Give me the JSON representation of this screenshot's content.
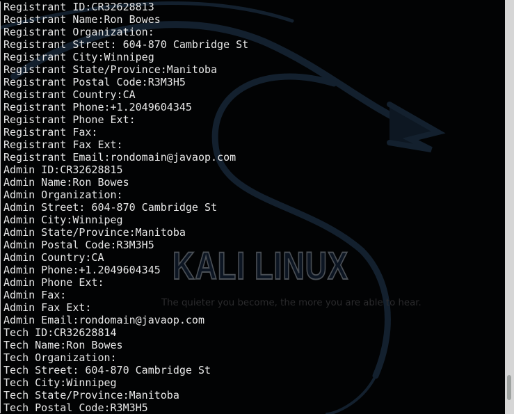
{
  "terminal": {
    "lines": [
      "Registrant ID:CR32628813",
      "Registrant Name:Ron Bowes",
      "Registrant Organization:",
      "Registrant Street: 604-870 Cambridge St",
      "Registrant City:Winnipeg",
      "Registrant State/Province:Manitoba",
      "Registrant Postal Code:R3M3H5",
      "Registrant Country:CA",
      "Registrant Phone:+1.2049604345",
      "Registrant Phone Ext:",
      "Registrant Fax:",
      "Registrant Fax Ext:",
      "Registrant Email:rondomain@javaop.com",
      "Admin ID:CR32628815",
      "Admin Name:Ron Bowes",
      "Admin Organization:",
      "Admin Street: 604-870 Cambridge St",
      "Admin City:Winnipeg",
      "Admin State/Province:Manitoba",
      "Admin Postal Code:R3M3H5",
      "Admin Country:CA",
      "Admin Phone:+1.2049604345",
      "Admin Phone Ext:",
      "Admin Fax:",
      "Admin Fax Ext:",
      "Admin Email:rondomain@javaop.com",
      "Tech ID:CR32628814",
      "Tech Name:Ron Bowes",
      "Tech Organization:",
      "Tech Street: 604-870 Cambridge St",
      "Tech City:Winnipeg",
      "Tech State/Province:Manitoba",
      "Tech Postal Code:R3M3H5"
    ]
  },
  "wallpaper": {
    "logo_text": "KALI LINUX",
    "tagline": "The quieter you become, the more you are able to hear."
  },
  "colors": {
    "background": "#020304",
    "text": "#e8e8e8",
    "scrollbar": "#d6d6d6",
    "thumb": "#9ea2a0"
  },
  "scroll": {
    "position_fraction": 0.97
  }
}
